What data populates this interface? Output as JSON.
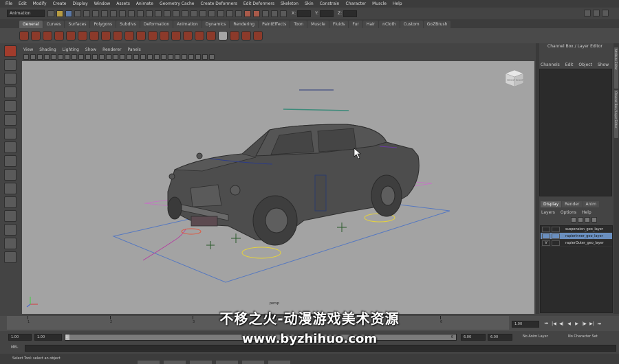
{
  "menubar": {
    "items": [
      "File",
      "Edit",
      "Modify",
      "Create",
      "Display",
      "Window",
      "Assets",
      "Animate",
      "Geometry Cache",
      "Create Deformers",
      "Edit Deformers",
      "Skeleton",
      "Skin",
      "Constrain",
      "Character",
      "Muscle",
      "Help"
    ]
  },
  "statusline": {
    "mode": "Animation",
    "x_label": "X:",
    "y_label": "Y:",
    "z_label": "Z:"
  },
  "shelf": {
    "tabs": [
      "General",
      "Curves",
      "Surfaces",
      "Polygons",
      "Subdivs",
      "Deformation",
      "Animation",
      "Dynamics",
      "Rendering",
      "PaintEffects",
      "Toon",
      "Muscle",
      "Fluids",
      "Fur",
      "Hair",
      "nCloth",
      "Custom",
      "GoZBrush"
    ],
    "active_tab": "General"
  },
  "viewport": {
    "menu": [
      "View",
      "Shading",
      "Lighting",
      "Show",
      "Renderer",
      "Panels"
    ],
    "viewcube_front": "FRONT",
    "viewcube_right": "RIGHT",
    "camera_label": "persp"
  },
  "channel_box": {
    "title": "Channel Box / Layer Editor",
    "menu": [
      "Channels",
      "Edit",
      "Object",
      "Show"
    ]
  },
  "side_tabs": [
    "Attribute Editor",
    "Channel Box / Layer Editor"
  ],
  "layer_editor": {
    "tabs": [
      "Display",
      "Render",
      "Anim"
    ],
    "active_tab": "Display",
    "menu": [
      "Layers",
      "Options",
      "Help"
    ],
    "layers": [
      {
        "name": "suspension_geo_layer",
        "visible": "",
        "selected": false
      },
      {
        "name": "rapierInner_geo_layer",
        "visible": "",
        "selected": true
      },
      {
        "name": "rapierOuter_geo_layer",
        "visible": "V",
        "selected": false
      }
    ]
  },
  "timeline": {
    "ticks": [
      "1",
      "2",
      "3",
      "4",
      "5",
      "6"
    ],
    "current_frame": "1.00"
  },
  "range": {
    "start": "1.00",
    "inner_start": "1.00",
    "slider_left_label": "1",
    "slider_right_label": "6",
    "end": "6.00",
    "outer_end": "6.00",
    "anim_layer": "No Anim Layer",
    "character_set": "No Character Set"
  },
  "command_line": {
    "label": "MEL"
  },
  "help_line": {
    "text": "Select Tool: select an object"
  },
  "watermark": {
    "line1": "不移之火-动漫游戏美术资源",
    "line2": "www.byzhihuo.com"
  }
}
